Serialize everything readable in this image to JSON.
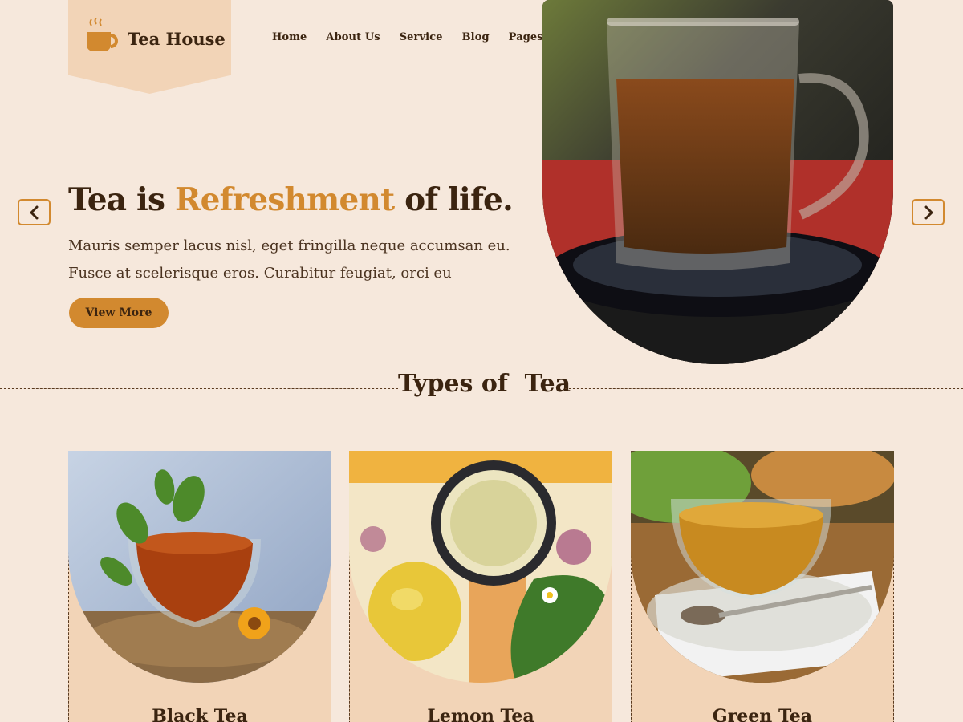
{
  "brand": {
    "name": "Tea House",
    "icon": "tea-cup-icon"
  },
  "nav": {
    "items": [
      "Home",
      "About Us",
      "Service",
      "Blog",
      "Pages"
    ]
  },
  "hero": {
    "title_start": "Tea is ",
    "title_accent": "Refreshment",
    "title_end": " of life.",
    "description_line1": "Mauris semper lacus nisl, eget fringilla neque accumsan eu.",
    "description_line2": "Fusce at scelerisque eros. Curabitur feugiat, orci eu",
    "cta_label": "View More",
    "prev_icon": "chevron-left-icon",
    "next_icon": "chevron-right-icon"
  },
  "types_section": {
    "title": "Types of  Tea",
    "cards": [
      {
        "name": "Black Tea"
      },
      {
        "name": "Lemon Tea"
      },
      {
        "name": "Green Tea"
      }
    ]
  },
  "colors": {
    "background": "#f6e8dc",
    "panel": "#f2d4b7",
    "accent": "#d2892f",
    "text": "#3b2410"
  }
}
